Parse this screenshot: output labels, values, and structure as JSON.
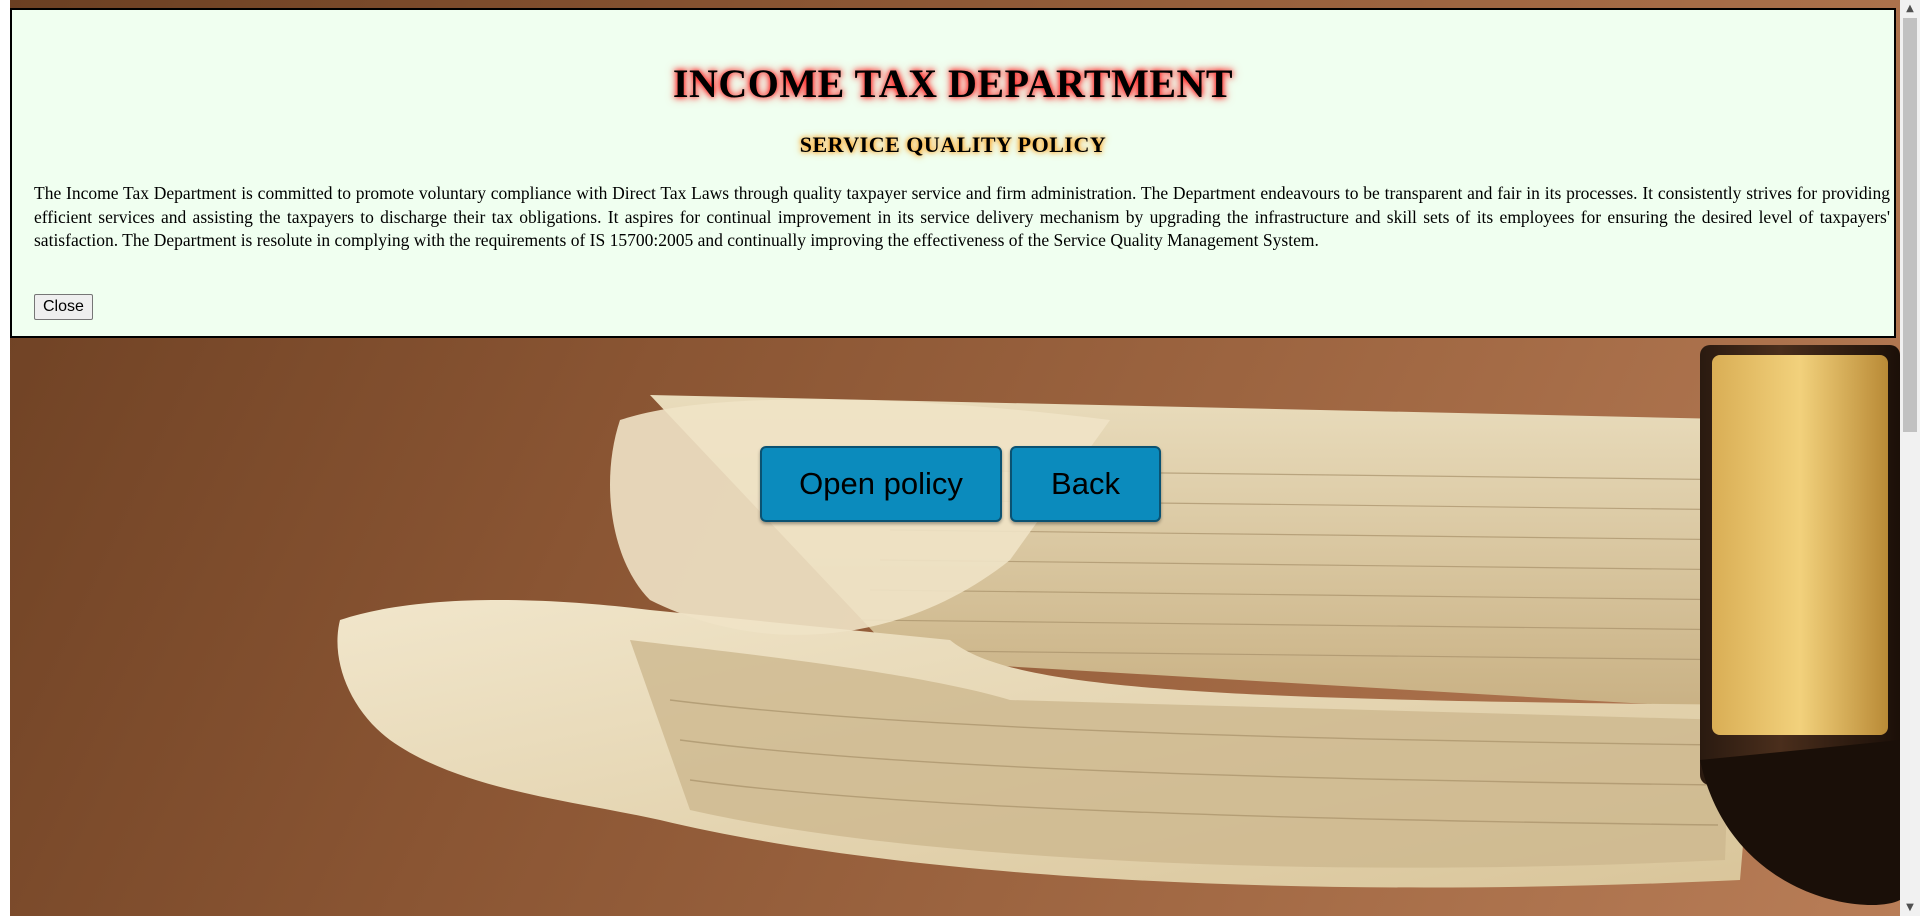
{
  "modal": {
    "title": "INCOME TAX DEPARTMENT",
    "subtitle": "SERVICE QUALITY POLICY",
    "body": "The Income Tax Department is committed to promote voluntary compliance with Direct Tax Laws through quality taxpayer service and firm administration. The Department endeavours to be transparent and fair in its processes. It consistently strives for providing efficient services and assisting the taxpayers to discharge their tax obligations. It aspires for continual improvement in its service delivery mechanism by upgrading the infrastructure and skill sets of its employees for ensuring the desired level of taxpayers' satisfaction. The Department is resolute in complying with the requirements of IS 15700:2005 and continually improving the effectiveness of the Service Quality Management System.",
    "close_label": "Close"
  },
  "actions": {
    "open_policy_label": "Open policy",
    "back_label": "Back"
  },
  "colors": {
    "modal_background": "#f0fff0",
    "button_background": "#0b8bbd",
    "title_glow": "#ff0000",
    "subtitle_glow": "#ff9900"
  },
  "icons": {
    "scroll_up": "scroll-up-arrow-icon",
    "scroll_down": "scroll-down-arrow-icon"
  }
}
